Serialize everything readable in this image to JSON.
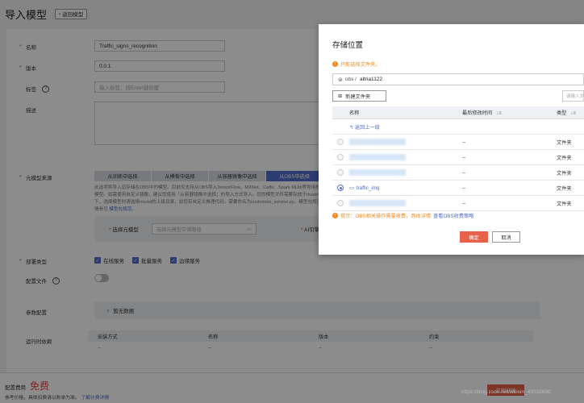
{
  "page": {
    "title": "导入模型",
    "back_label": "返回模型"
  },
  "form": {
    "name_label": "名称",
    "name_value": "Traffic_signs_recognition",
    "version_label": "版本",
    "version_value": "0.0.1",
    "tags_label": "标签",
    "tags_placeholder": "输入标签，按Enter键创建",
    "desc_label": "描述",
    "source_label": "元模型来源",
    "source_tabs": [
      "从训练中选择",
      "从模板中选择",
      "从容器镜像中选择",
      "从OBS中选择"
    ],
    "source_desc": "此选项将导入您存储在OBS中的模型。目前仅支持从OBS导入TensorFlow、MXNet、Caffe、Spark MLlib等常用框架模型。如需使用自定义镜像，建议您使用「从容器镜像中选择」的导入方式导入。您的模型文件需要存放于model目录下，选择模型时请选择model的上级目录，如您有自定义推理代码，需要命名为customize_service.py。模型包规范详情参见",
    "source_desc_link": "模型包规范。",
    "select_model_label": "选择元模型",
    "select_model_placeholder": "选择元模型存储路径",
    "ai_engine_label": "AI引擎",
    "deploy_type_label": "部署类型",
    "deploy_types": [
      "在线服务",
      "批量服务",
      "边缘服务"
    ],
    "config_file_label": "配置文件",
    "params_label": "参数配置",
    "params_value": "暂无数据",
    "runtime_label": "运行时依赖",
    "runtime_headers": [
      "安装方式",
      "名称",
      "版本",
      "约束"
    ],
    "runtime_row": [
      "--",
      "--",
      "--",
      "--"
    ]
  },
  "footer": {
    "fee_label": "配置费用",
    "fee_value": "免费",
    "fee_note": "参考价格，具体扣费请以账单为准。",
    "fee_link": "了解计费详情",
    "create_label": "立即创建"
  },
  "watermark": "https://blog.csdn.net/weixin_43033680",
  "modal": {
    "title": "存储位置",
    "warning": "只能选择文件夹。",
    "path_prefix": "obs /",
    "path_folder": "altria1122",
    "new_folder_label": "新建文件夹",
    "filter_placeholder": "请输入文件夹名称",
    "col_name": "名称",
    "col_time": "最后修改时间",
    "col_type": "类型",
    "up_link": "返回上一级",
    "rows": [
      {
        "name": "",
        "time": "--",
        "type": "文件夹",
        "selected": false
      },
      {
        "name": "",
        "time": "--",
        "type": "文件夹",
        "selected": false
      },
      {
        "name": "",
        "time": "--",
        "type": "文件夹",
        "selected": false
      },
      {
        "name": "traffic_img",
        "time": "--",
        "type": "文件夹",
        "selected": true
      },
      {
        "name": "",
        "time": "--",
        "type": "文件夹",
        "selected": false
      }
    ],
    "tip": "提示：OBS相关操作需要收费，具体详情",
    "tip_link": "查看OBS收费策略",
    "ok_label": "确定",
    "cancel_label": "取消"
  },
  "icons": {
    "back": "chevron-left-icon",
    "help": "question-circle-icon",
    "folder": "folder-icon",
    "bucket": "bucket-icon",
    "warn": "info-icon",
    "sort": "sort-icon",
    "arrow": "arrow-up-icon"
  },
  "colors": {
    "primary": "#526ecc",
    "danger": "#e8624a",
    "warning": "#f08a24"
  }
}
